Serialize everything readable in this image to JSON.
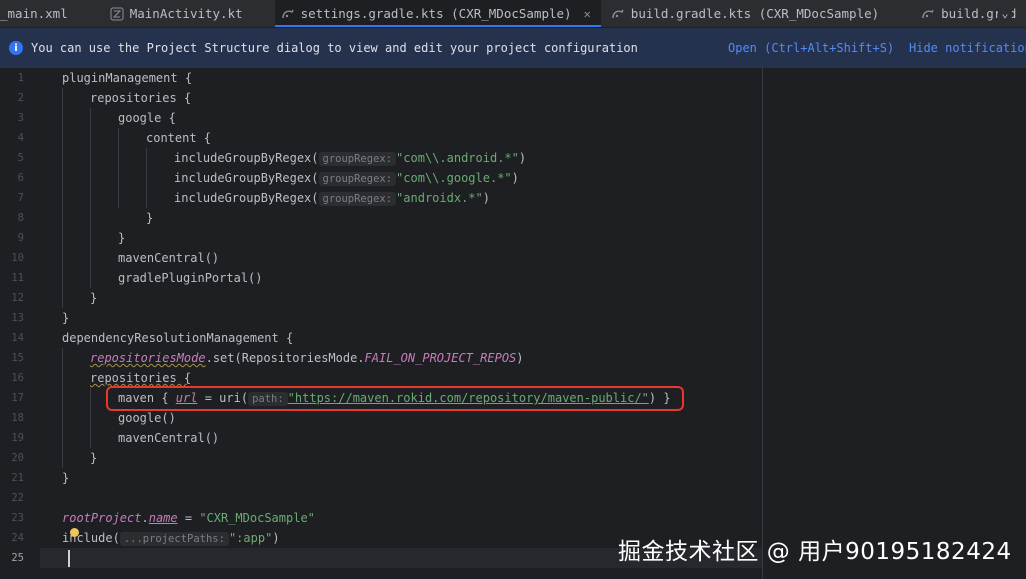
{
  "tabs": [
    {
      "label": "_main.xml",
      "active": false,
      "icon": "xml-file-icon"
    },
    {
      "label": "MainActivity.kt",
      "active": false,
      "icon": "kotlin-file-icon"
    },
    {
      "label": "settings.gradle.kts (CXR_MDocSample)",
      "active": true,
      "icon": "gradle-file-icon"
    },
    {
      "label": "build.gradle.kts (CXR_MDocSample)",
      "active": false,
      "icon": "gradle-file-icon"
    },
    {
      "label": "build.grad",
      "active": false,
      "icon": "gradle-file-icon"
    }
  ],
  "tab_close": "✕",
  "tab_overflow": "⌄",
  "notification": {
    "message": "You can use the Project Structure dialog to view and edit your project configuration",
    "open_link": "Open (Ctrl+Alt+Shift+S)",
    "hide_link": "Hide notification"
  },
  "editor": {
    "line_numbers": [
      "1",
      "2",
      "3",
      "4",
      "5",
      "6",
      "7",
      "8",
      "9",
      "10",
      "11",
      "12",
      "13",
      "14",
      "15",
      "16",
      "17",
      "18",
      "19",
      "20",
      "21",
      "22",
      "23",
      "24",
      "25"
    ],
    "current_line": "25",
    "lines": {
      "l1": "pluginManagement {",
      "l2": "repositories {",
      "l3": "google {",
      "l4": "content {",
      "l5a": "includeGroupByRegex(",
      "l5hint": "groupRegex:",
      "l5s": "\"com\\\\.android.*\"",
      "l5e": ")",
      "l6a": "includeGroupByRegex(",
      "l6hint": "groupRegex:",
      "l6s": "\"com\\\\.google.*\"",
      "l6e": ")",
      "l7a": "includeGroupByRegex(",
      "l7hint": "groupRegex:",
      "l7s": "\"androidx.*\"",
      "l7e": ")",
      "l8": "}",
      "l9": "}",
      "l10": "mavenCentral()",
      "l11": "gradlePluginPortal()",
      "l12": "}",
      "l13": "}",
      "l14": "dependencyResolutionManagement {",
      "l15a": "repositoriesMode",
      "l15b": ".set(RepositoriesMode.",
      "l15c": "FAIL_ON_PROJECT_REPOS",
      "l15d": ")",
      "l16": "repositories {",
      "l17a": "maven { ",
      "l17b": "url",
      "l17c": " = uri(",
      "l17hint": "path:",
      "l17s": "\"https://maven.rokid.com/repository/maven-public/\"",
      "l17e": ") }",
      "l18": "google()",
      "l19": "mavenCentral()",
      "l20": "}",
      "l21": "}",
      "l22": "",
      "l23a": "rootProject",
      "l23b": ".",
      "l23c": "name",
      "l23d": " = ",
      "l23s": "\"CXR_MDocSample\"",
      "l24a": "include(",
      "l24hint": "...projectPaths:",
      "l24s": "\":app\"",
      "l24e": ")"
    }
  },
  "watermark": "掘金技术社区 @ 用户90195182424",
  "colors": {
    "background": "#1e1f22",
    "string": "#6aab73",
    "property": "#c77dbb",
    "highlight_box": "#e8372d",
    "link": "#548af7"
  }
}
